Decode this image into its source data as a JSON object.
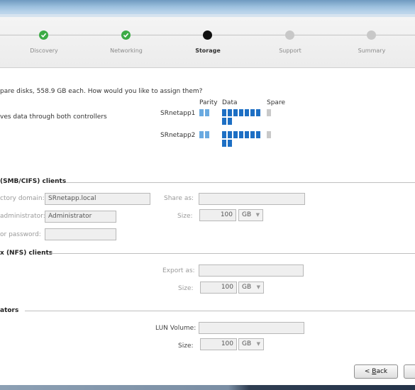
{
  "wizard": {
    "steps": [
      {
        "label": "Discovery",
        "state": "done"
      },
      {
        "label": "Networking",
        "state": "done"
      },
      {
        "label": "Storage",
        "state": "current"
      },
      {
        "label": "Support",
        "state": "todo"
      },
      {
        "label": "Summary",
        "state": "todo"
      }
    ]
  },
  "disks": {
    "question": "pare disks, 558.9 GB each. How would you like to assign them?",
    "option_text": "ves data through both controllers",
    "col_parity": "Parity",
    "col_data": "Data",
    "col_spare": "Spare",
    "controllers": [
      {
        "name": "SRnetapp1",
        "parity": 2,
        "data": 9,
        "spare": 1
      },
      {
        "name": "SRnetapp2",
        "parity": 2,
        "data": 9,
        "spare": 1
      }
    ]
  },
  "smb": {
    "title": "(SMB/CIFS) clients",
    "domain_label": "ctory domain:",
    "domain_value": "SRnetapp.local",
    "admin_label": "administrator:",
    "admin_value": "Administrator",
    "password_label": "or password:",
    "password_value": "",
    "share_label": "Share as:",
    "share_value": "",
    "size_label": "Size:",
    "size_value": "100",
    "size_unit": "GB"
  },
  "nfs": {
    "title": "x (NFS) clients",
    "export_label": "Export as:",
    "export_value": "",
    "size_label": "Size:",
    "size_value": "100",
    "size_unit": "GB"
  },
  "iscsi": {
    "title": "ators",
    "lun_label": "LUN Volume:",
    "lun_value": "",
    "size_label": "Size:",
    "size_value": "100",
    "size_unit": "GB"
  },
  "buttons": {
    "back_prefix": "< ",
    "back_u": "B",
    "back_rest": "ack"
  },
  "colors": {
    "done": "#3cab45",
    "current": "#101010",
    "parity": "#6aaae0",
    "data": "#1d6fc4",
    "spare": "#c9c9c9"
  }
}
